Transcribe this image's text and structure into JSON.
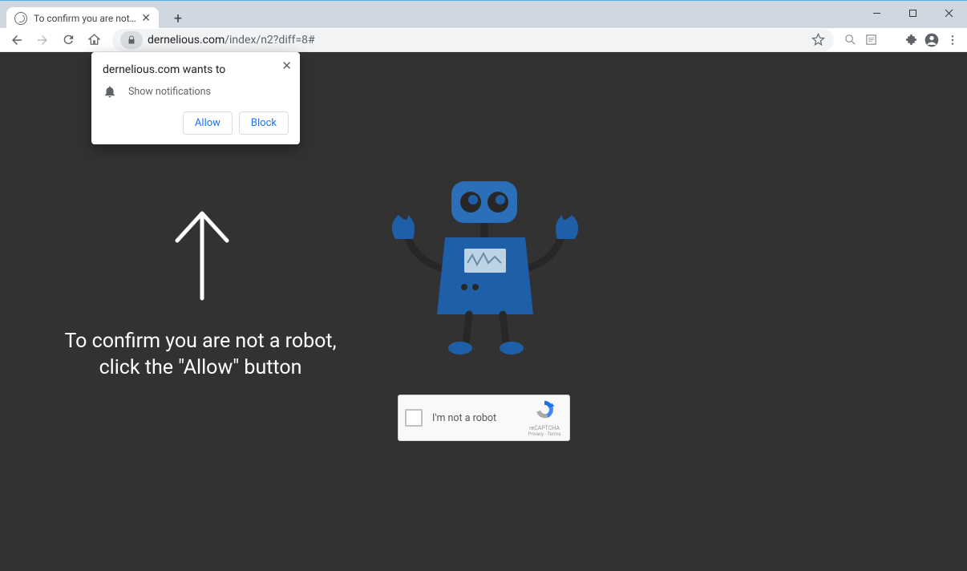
{
  "window": {
    "tab_title": "To confirm you are not a robot, c",
    "minimize_tip": "Minimize",
    "maximize_tip": "Maximize",
    "close_tip": "Close"
  },
  "toolbar": {
    "url_host": "dernelious.com",
    "url_path": "/index/n2?diff=8#"
  },
  "prompt": {
    "title": "dernelious.com wants to",
    "permission": "Show notifications",
    "allow": "Allow",
    "block": "Block"
  },
  "page": {
    "line1": "To confirm you are not a robot,",
    "line2": "click the \"Allow\" button"
  },
  "captcha": {
    "label": "I'm not a robot",
    "brand": "reCAPTCHA",
    "links": "Privacy - Terms"
  }
}
